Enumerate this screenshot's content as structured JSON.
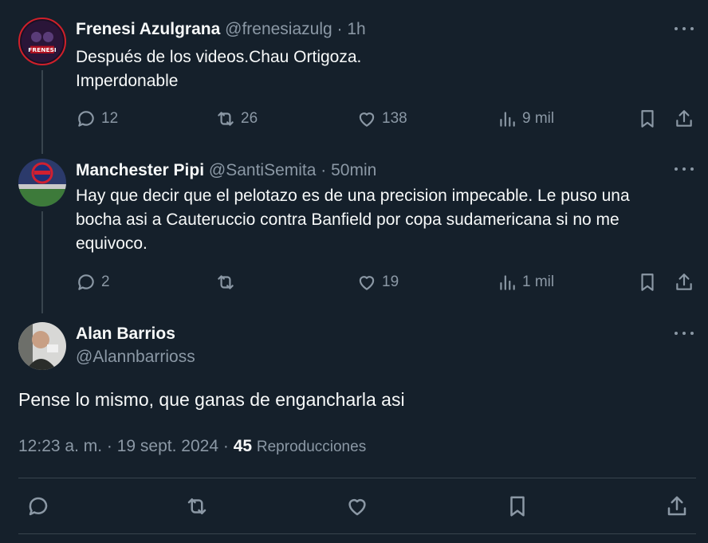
{
  "tweets": [
    {
      "name": "Frenesi Azulgrana",
      "handle": "@frenesiazulg",
      "time": "· 1h",
      "avatar_text": "FRENESI",
      "lines": [
        "Después de los videos.Chau Ortigoza.",
        "Imperdonable"
      ],
      "replies": "12",
      "retweets": "26",
      "likes": "138",
      "views": "9 mil"
    },
    {
      "name": "Manchester Pipi",
      "handle": "@SantiSemita",
      "time": "· 50min",
      "lines": [
        "Hay que decir que el pelotazo es de una precision impecable. Le puso una",
        "bocha asi a Cauteruccio contra Banfield por copa sudamericana si no me",
        "equivoco."
      ],
      "replies": "2",
      "retweets": "",
      "likes": "19",
      "views": "1 mil"
    }
  ],
  "main_tweet": {
    "name": "Alan Barrios",
    "handle": "@Alannbarrioss",
    "text": "Pense lo mismo, que ganas de engancharla asi",
    "time": "12:23 a. m.",
    "date": "· 19 sept. 2024 ·",
    "views_count": "45",
    "views_label": "Reproducciones"
  },
  "colors": {
    "background": "#15202b",
    "text": "#f7f9f9",
    "muted": "#8b98a5",
    "divider": "#38444d"
  }
}
